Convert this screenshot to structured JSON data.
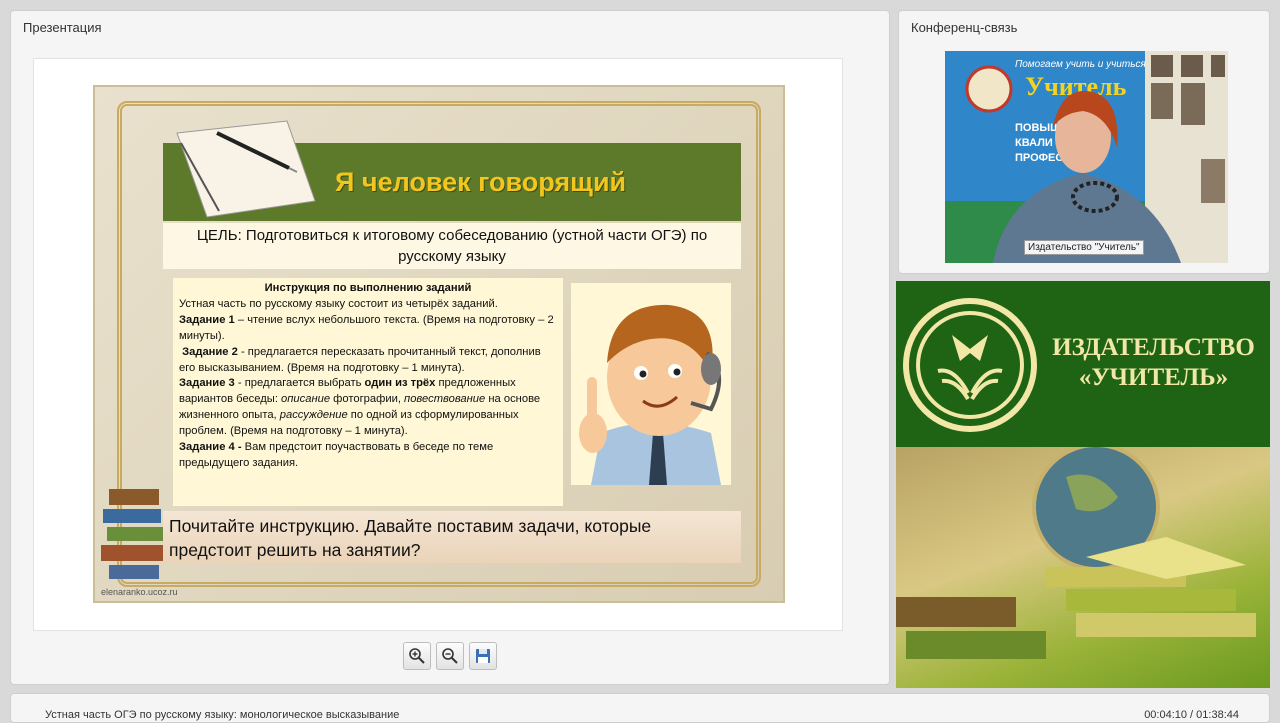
{
  "presentation_panel": {
    "title": "Презентация"
  },
  "conference_panel": {
    "title": "Конференц-связь",
    "video_caption": "Издательство \"Учитель\""
  },
  "slide": {
    "title": "Я человек говорящий",
    "goal": "ЦЕЛЬ: Подготовиться к итоговому собеседованию (устной части ОГЭ) по русскому языку",
    "instruction": {
      "heading": "Инструкция по выполнению заданий",
      "intro": "Устная часть по русскому языку состоит из четырёх заданий.",
      "task1_label": "Задание 1",
      "task1_text": " – чтение вслух небольшого текста. (Время на подготовку – 2 минуты).",
      "task2_label": "Задание 2",
      "task2_text": " - предлагается пересказать прочитанный текст, дополнив его высказыванием. (Время на подготовку – 1 минута).",
      "task3_label": "Задание 3",
      "task3_text_a": " - предлагается выбрать ",
      "task3_bold": "один из трёх",
      "task3_text_b": " предложенных вариантов беседы: ",
      "task3_it1": "описание",
      "task3_text_c": " фотографии, ",
      "task3_it2": "повествование",
      "task3_text_d": " на основе жизненного опыта, ",
      "task3_it3": "рассуждение",
      "task3_text_e": " по одной из сформулированных проблем. (Время на подготовку – 1 минута).",
      "task4_label": "Задание 4 -",
      "task4_text": "  Вам предстоит поучаствовать в беседе по теме предыдущего задания."
    },
    "prompt": "Почитайте инструкцию. Давайте поставим задачи, которые предстоит решить на занятии?",
    "watermark": "elenaranko.ucoz.ru"
  },
  "toolbar": {
    "zoom_in": "zoom-in",
    "zoom_out": "zoom-out",
    "save": "save"
  },
  "publisher": {
    "line1": "ИЗДАТЕЛЬСТВО",
    "line2": "«УЧИТЕЛЬ»"
  },
  "video_poster": {
    "line1": "Помогаем учить и учиться",
    "brand": "Учитель",
    "b1": "ПОВЫШЕНИ",
    "b2": "КВАЛИ",
    "b3": "ПРОФЕСС"
  },
  "footer": {
    "title": "Устная часть ОГЭ по русскому языку: монологическое высказывание",
    "time": "00:04:10 / 01:38:44"
  },
  "colors": {
    "slide_green": "#5d7a2b",
    "slide_title": "#f2c51f",
    "publisher_green": "#1f6414"
  }
}
